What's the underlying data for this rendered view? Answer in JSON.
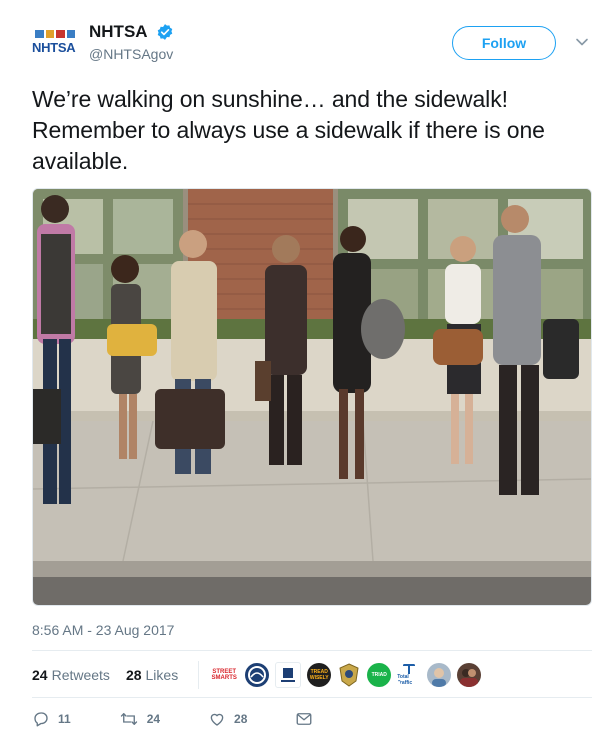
{
  "account": {
    "logo_text": "NHTSA",
    "display_name": "NHTSA",
    "handle": "@NHTSAgov",
    "verified_icon": "verified-badge-icon"
  },
  "header": {
    "follow_label": "Follow",
    "menu_icon": "chevron-down-icon"
  },
  "tweet": {
    "text": "We’re walking on sunshine… and the sidewalk! Remember to always use a sidewalk if there is one available.",
    "image": "photo of people walking on a city sidewalk",
    "timestamp": "8:56 AM - 23 Aug 2017"
  },
  "stats": {
    "retweets_count": "24",
    "retweets_label": "Retweets",
    "likes_count": "28",
    "likes_label": "Likes",
    "liker_avatars": [
      {
        "text": "STREET SMARTS"
      },
      {
        "text": ""
      },
      {
        "text": ""
      },
      {
        "text": "TREAD WISELY"
      },
      {
        "text": ""
      },
      {
        "text": "TRIAD"
      },
      {
        "text": "Total Traffic"
      },
      {
        "text": ""
      },
      {
        "text": ""
      }
    ]
  },
  "actions": {
    "reply_count": "11",
    "retweet_count": "24",
    "like_count": "28"
  },
  "colors": {
    "accent": "#1da1f2",
    "text": "#14171a",
    "muted": "#657786",
    "border": "#e6ecf0"
  }
}
